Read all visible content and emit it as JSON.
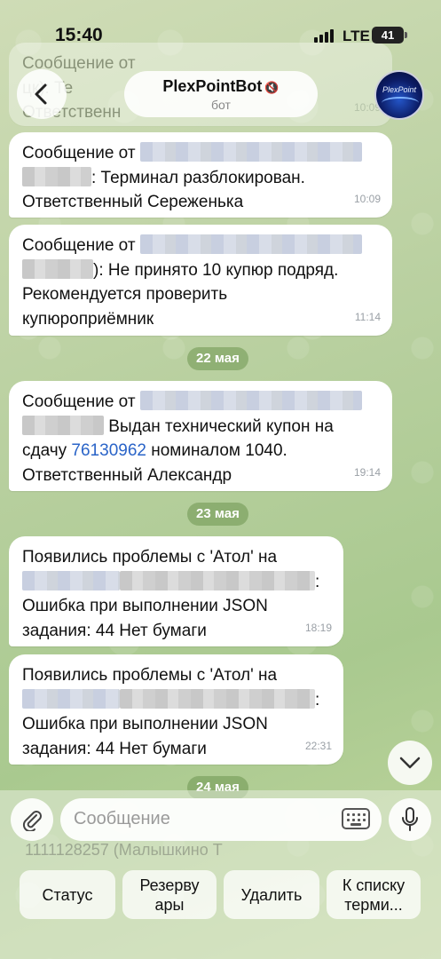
{
  "status_bar": {
    "time": "15:40",
    "network": "LTE",
    "battery": "41"
  },
  "header": {
    "title": "PlexPointBot",
    "subtitle": "бот",
    "avatar_text": "PlexPoint"
  },
  "messages": [
    {
      "line1": "Сообщение от",
      "line2_suffix": ": Терминал разблокирован.",
      "line3": "Ответственный Сереженька",
      "time": "10:09"
    },
    {
      "line1": "Сообщение от",
      "line2_suffix": "): Не принято 10 купюр подряд.",
      "line3": "Рекомендуется проверить",
      "line4": "купюроприёмник",
      "time": "11:14"
    },
    {
      "line1": "Сообщение от",
      "line2_suffix": " Выдан технический купон на",
      "line3_prefix": "сдачу",
      "coupon": "76130962",
      "line3_suffix": "номиналом 1040.",
      "line4": "Ответственный Александр",
      "time": "19:14"
    },
    {
      "line1": "Появились проблемы с 'Атол' на",
      "line2_suffix": ":",
      "line3": "Ошибка при выполнении JSON",
      "line4": "задания: 44 Нет бумаги",
      "time": "18:19"
    },
    {
      "line1": "Появились проблемы с 'Атол' на",
      "line2_suffix": ":",
      "line3": "Ошибка при выполнении JSON",
      "line4": "задания: 44 Нет бумаги",
      "time": "22:31"
    }
  ],
  "top_faded": {
    "line1": "Сообщение от",
    "line2": "цк): Те",
    "line3": "Ответственн",
    "time": "10:09"
  },
  "dates": {
    "d1": "22 мая",
    "d2": "23 мая",
    "d3": "24 мая"
  },
  "input": {
    "placeholder": "Сообщение"
  },
  "bottom_faded": "1111128257 (Малышкино Т",
  "keyboard_buttons": [
    {
      "label": "Статус"
    },
    {
      "label": "Резерву\nары"
    },
    {
      "label": "Удалить"
    },
    {
      "label": "К списку\nтерми..."
    }
  ]
}
